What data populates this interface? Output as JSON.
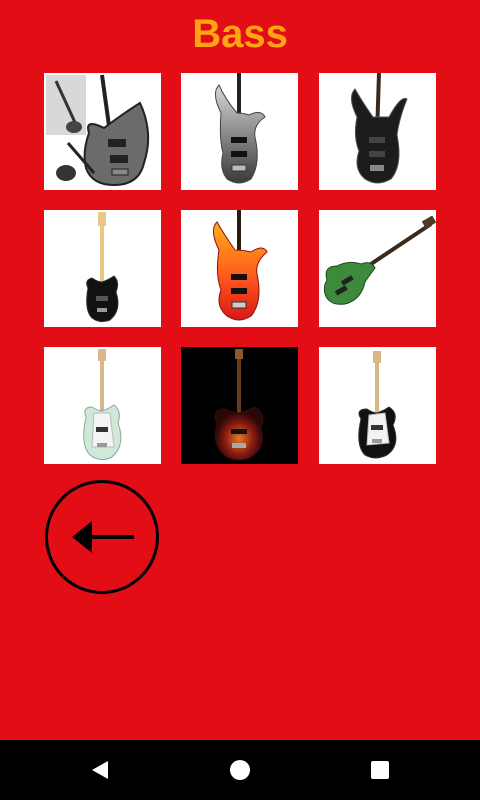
{
  "header": {
    "title": "Bass"
  },
  "colors": {
    "background": "#e30d16",
    "title": "#ffa414",
    "navbar": "#000000"
  },
  "grid": {
    "items": [
      {
        "icon": "bass-guitar-gray-five-string-icon"
      },
      {
        "icon": "bass-guitar-silver-burst-icon"
      },
      {
        "icon": "bass-guitar-black-icon"
      },
      {
        "icon": "bass-guitar-black-maple-icon"
      },
      {
        "icon": "bass-guitar-orange-red-burst-icon"
      },
      {
        "icon": "bass-guitar-green-icon"
      },
      {
        "icon": "bass-guitar-seafoam-icon"
      },
      {
        "icon": "bass-guitar-dark-red-burst-icon"
      },
      {
        "icon": "bass-guitar-black-white-pickguard-icon"
      }
    ]
  },
  "back_button": {
    "icon": "arrow-left-icon"
  },
  "navbar": {
    "back_icon": "nav-back-triangle-icon",
    "home_icon": "nav-home-circle-icon",
    "recents_icon": "nav-recents-square-icon"
  }
}
